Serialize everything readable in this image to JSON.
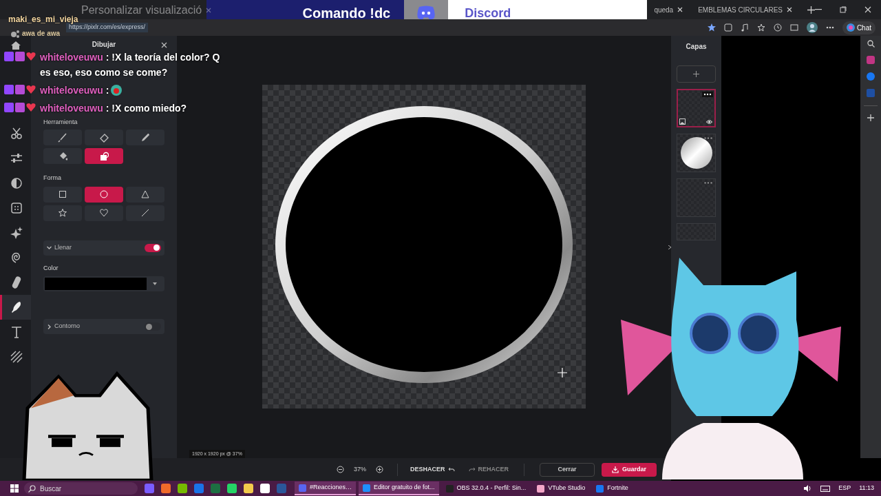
{
  "browser": {
    "tabs": [
      {
        "label": "Personalizar visualizació",
        "selected": false
      },
      {
        "label": "queda",
        "selected": false
      },
      {
        "label": "EMBLEMAS CIRCULARES",
        "selected": false
      }
    ],
    "url": "https://pixlr.com/es/express/",
    "chat_button": "Chat"
  },
  "stream_overlay": {
    "banner": "Comando !dc",
    "discord": "Discord",
    "streamer": "maki_es_mi_vieja",
    "status": "awa de awa",
    "chat": [
      {
        "user": "whiteloveuwu",
        "separator": ":",
        "kind": "text",
        "message": "!X la teoría del color? Q es eso, eso como se come?"
      },
      {
        "user": "whiteloveuwu",
        "separator": ":",
        "kind": "emote"
      },
      {
        "user": "whiteloveuwu",
        "separator": ":",
        "kind": "text",
        "message": "!X como miedo?"
      }
    ]
  },
  "editor": {
    "rail": [
      {
        "kind": "cut",
        "selected": false
      },
      {
        "kind": "adjust",
        "selected": false
      },
      {
        "kind": "contrast",
        "selected": false
      },
      {
        "kind": "texture",
        "selected": false
      },
      {
        "kind": "sparkle",
        "selected": false
      },
      {
        "kind": "spiral",
        "selected": false
      },
      {
        "kind": "bandage",
        "selected": false
      },
      {
        "kind": "draw",
        "selected": true
      },
      {
        "kind": "text",
        "selected": false
      },
      {
        "kind": "pattern",
        "selected": false
      }
    ],
    "panel_title": "Dibujar",
    "tool_label": "Herramienta",
    "tools": [
      {
        "kind": "brush",
        "selected": false
      },
      {
        "kind": "eraser",
        "selected": false
      },
      {
        "kind": "pen",
        "selected": false
      },
      {
        "kind": "fill",
        "selected": false
      },
      {
        "kind": "shape",
        "selected": true
      }
    ],
    "shape_label": "Forma",
    "shapes": [
      {
        "kind": "square",
        "selected": false
      },
      {
        "kind": "circle",
        "selected": true
      },
      {
        "kind": "triangle",
        "selected": false
      },
      {
        "kind": "star",
        "selected": false
      },
      {
        "kind": "heart",
        "selected": false
      },
      {
        "kind": "line",
        "selected": false
      }
    ],
    "fill": {
      "label": "Llenar",
      "on": true,
      "expanded": true
    },
    "color_label": "Color",
    "outline": {
      "label": "Contorno",
      "on": false,
      "expanded": false
    },
    "status": "1920 x 1920 px @ 37%",
    "zoom": "37%",
    "undo": "DESHACER",
    "redo": "REHACER",
    "close": "Cerrar",
    "save": "Guardar",
    "layers": {
      "title": "Capas",
      "items": [
        {
          "kind": "empty",
          "selected": true
        },
        {
          "kind": "sphere",
          "selected": false
        },
        {
          "kind": "empty",
          "selected": false
        },
        {
          "kind": "empty",
          "selected": false
        }
      ]
    }
  },
  "taskbar": {
    "search": "Buscar",
    "apps": [
      {
        "label": "#Reacciones…",
        "selected": true
      },
      {
        "label": "Editor gratuito de fot...",
        "selected": true
      },
      {
        "label": "OBS 32.0.4 - Perfil: Sin...",
        "selected": false
      },
      {
        "label": "VTube Studio",
        "selected": false
      },
      {
        "label": "Fortnite",
        "selected": false
      }
    ],
    "language": "ESP",
    "time": "11:13"
  }
}
